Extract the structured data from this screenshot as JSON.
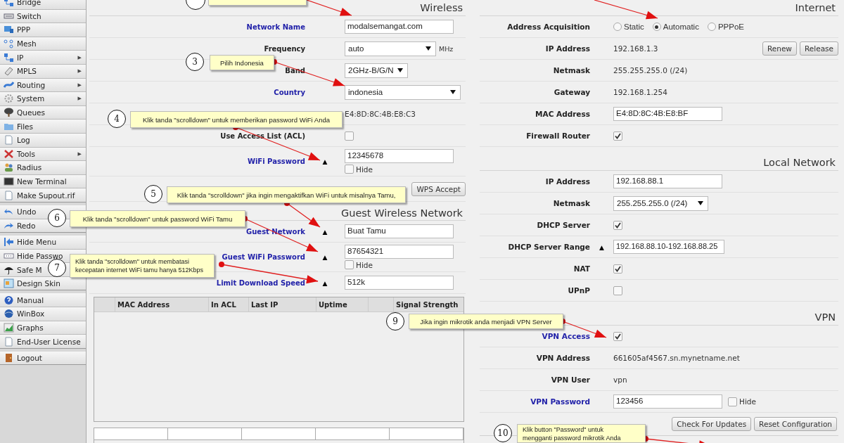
{
  "sidebar": {
    "groups": [
      {
        "items": [
          {
            "label": "Bridge"
          },
          {
            "label": "Switch"
          },
          {
            "label": "PPP"
          },
          {
            "label": "Mesh"
          },
          {
            "label": "IP",
            "submenu": "▶"
          },
          {
            "label": "MPLS",
            "submenu": "▶"
          },
          {
            "label": "Routing",
            "submenu": "▶"
          },
          {
            "label": "System",
            "submenu": "▶"
          },
          {
            "label": "Queues"
          },
          {
            "label": "Files"
          },
          {
            "label": "Log"
          },
          {
            "label": "Tools",
            "submenu": "▶"
          },
          {
            "label": "Radius"
          },
          {
            "label": "New Terminal"
          },
          {
            "label": "Make Supout.rif"
          }
        ]
      },
      {
        "items": [
          {
            "label": "Undo"
          },
          {
            "label": "Redo"
          }
        ]
      },
      {
        "items": [
          {
            "label": "Hide Menu"
          },
          {
            "label": "Hide Passwo"
          },
          {
            "label": "Safe M"
          },
          {
            "label": "Design Skin"
          }
        ]
      },
      {
        "items": [
          {
            "label": "Manual"
          },
          {
            "label": "WinBox"
          },
          {
            "label": "Graphs"
          },
          {
            "label": "End-User License"
          }
        ]
      },
      {
        "items": [
          {
            "label": "Logout"
          }
        ]
      }
    ]
  },
  "wireless": {
    "title": "Wireless",
    "rows": [
      {
        "label": "Network Name",
        "color": "#1f1fa8",
        "kind": "input",
        "value": "modalsemangat.com"
      },
      {
        "label": "Frequency",
        "color": "#222222",
        "kind": "select",
        "value": "auto",
        "unit": "MHz"
      },
      {
        "label": "Band",
        "color": "#222222",
        "kind": "select",
        "value": "2GHz-B/G/N"
      },
      {
        "label": "Country",
        "color": "#1f1fa8",
        "kind": "select",
        "value": "indonesia"
      },
      {
        "kind": "text",
        "value": "E4:8D:8C:4B:E8:C3"
      },
      {
        "label": "Use Access List (ACL)",
        "color": "#222222",
        "kind": "checkbox",
        "checked": false
      },
      {
        "label": "WiFi Password",
        "color": "#1f1fa8",
        "toggle": "▲",
        "kind": "input",
        "value": "12345678",
        "hide": {
          "label": "Hide",
          "checked": false
        }
      }
    ]
  },
  "wps_button": "WPS Accept",
  "guest": {
    "title": "Guest Wireless Network",
    "rows": [
      {
        "label": "Guest Network",
        "color": "#1f1fa8",
        "toggle": "▲",
        "kind": "input",
        "value": "Buat Tamu"
      },
      {
        "label": "Guest WiFi Password",
        "color": "#1f1fa8",
        "toggle": "▲",
        "kind": "input",
        "value": "87654321",
        "hide": {
          "label": "Hide",
          "checked": false
        }
      },
      {
        "label": "Limit Download Speed",
        "color": "#1f1fa8",
        "toggle": "▲",
        "kind": "input",
        "value": "512k"
      }
    ]
  },
  "clients_table": {
    "columns": [
      "MAC Address",
      "In ACL",
      "Last IP",
      "Uptime",
      "Signal Strength"
    ]
  },
  "internet": {
    "title": "Internet",
    "rows": [
      {
        "label": "Address Acquisition",
        "color": "#222222",
        "kind": "radio",
        "options": [
          {
            "label": "Static",
            "selected": false
          },
          {
            "label": "Automatic",
            "selected": true
          },
          {
            "label": "PPPoE",
            "selected": false
          }
        ]
      },
      {
        "label": "IP Address",
        "color": "#222222",
        "kind": "text",
        "value": "192.168.1.3",
        "buttons": [
          "Renew",
          "Release"
        ]
      },
      {
        "label": "Netmask",
        "color": "#222222",
        "kind": "text",
        "value": "255.255.255.0 (/24)"
      },
      {
        "label": "Gateway",
        "color": "#222222",
        "kind": "text",
        "value": "192.168.1.254"
      },
      {
        "label": "MAC Address",
        "color": "#222222",
        "kind": "input",
        "value": "E4:8D:8C:4B:E8:BF"
      },
      {
        "label": "Firewall Router",
        "color": "#222222",
        "kind": "checkbox",
        "checked": true
      }
    ]
  },
  "local": {
    "title": "Local Network",
    "rows": [
      {
        "label": "IP Address",
        "color": "#222222",
        "kind": "input",
        "value": "192.168.88.1"
      },
      {
        "label": "Netmask",
        "color": "#222222",
        "kind": "select",
        "value": "255.255.255.0 (/24)"
      },
      {
        "label": "DHCP Server",
        "color": "#222222",
        "kind": "checkbox",
        "checked": true
      },
      {
        "label": "DHCP Server Range",
        "color": "#222222",
        "toggle": "▲",
        "kind": "input",
        "value": "192.168.88.10-192.168.88.25"
      },
      {
        "label": "NAT",
        "color": "#222222",
        "kind": "checkbox",
        "checked": true
      },
      {
        "label": "UPnP",
        "color": "#222222",
        "kind": "checkbox",
        "checked": false
      }
    ]
  },
  "vpn": {
    "title": "VPN",
    "rows": [
      {
        "label": "VPN Access",
        "color": "#1f1fa8",
        "kind": "checkbox",
        "checked": true
      },
      {
        "label": "VPN Address",
        "color": "#222222",
        "kind": "text",
        "value": "661605af4567.sn.mynetname.net"
      },
      {
        "label": "VPN User",
        "color": "#222222",
        "kind": "text",
        "value": "vpn"
      },
      {
        "label": "VPN Password",
        "color": "#1f1fa8",
        "kind": "input",
        "value": "123456",
        "hide": {
          "label": "Hide",
          "checked": false
        }
      }
    ]
  },
  "buttons": [
    "Check For Updates",
    "Reset Configuration"
  ],
  "callouts": [
    {
      "number": "3",
      "lines": [
        "Pilih Indonesia"
      ]
    },
    {
      "number": "4",
      "lines": [
        "Klik tanda \"scrolldown\" untuk memberikan password WiFi Anda"
      ]
    },
    {
      "number": "5",
      "lines": [
        "Klik tanda \"scrolldown\" jika ingin mengaktifkan WiFi untuk misalnya Tamu,"
      ]
    },
    {
      "number": "6",
      "lines": [
        "Klik tanda \"scrolldown\" untuk password WiFi Tamu"
      ]
    },
    {
      "number": "7",
      "lines": [
        "Klik tanda \"scrolldown\" untuk membatasi",
        "kecepatan internet WiFi tamu hanya 512Kbps"
      ]
    },
    {
      "number": "9",
      "lines": [
        "Jika ingin mikrotik anda menjadi VPN Server"
      ]
    },
    {
      "number": "10",
      "lines": [
        "Klik button \"Password\" untuk",
        "mengganti password mikrotik Anda"
      ]
    }
  ]
}
